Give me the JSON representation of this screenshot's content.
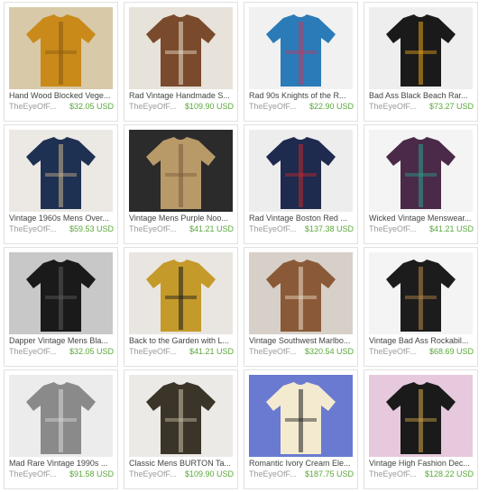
{
  "listings": [
    {
      "title": "Hand Wood Blocked Vege...",
      "shop": "TheEyeOfF...",
      "price": "$32.05 USD",
      "icon": "mustard-shirt-photo",
      "bg": "#d8c9a8",
      "main": "#c98a1a",
      "accent": "#8a5a10"
    },
    {
      "title": "Rad Vintage Handmade S...",
      "shop": "TheEyeOfF...",
      "price": "$109.90 USD",
      "icon": "nordic-cardigan-photo",
      "bg": "#e7e2da",
      "main": "#7a4a2c",
      "accent": "#e8e1cf"
    },
    {
      "title": "Rad 90s Knights of the R...",
      "shop": "TheEyeOfF...",
      "price": "$22.90 USD",
      "icon": "plaid-shirt-photo",
      "bg": "#f1f1f1",
      "main": "#2a7bb8",
      "accent": "#c23a5e"
    },
    {
      "title": "Bad Ass Black Beach Rar...",
      "shop": "TheEyeOfF...",
      "price": "$73.27 USD",
      "icon": "beach-shirt-photo",
      "bg": "#eeeeee",
      "main": "#1a1a1a",
      "accent": "#e8a21a"
    },
    {
      "title": "Vintage 1960s Mens Over...",
      "shop": "TheEyeOfF...",
      "price": "$59.53 USD",
      "icon": "navy-cardigan-photo",
      "bg": "#ece9e4",
      "main": "#1f3152",
      "accent": "#c9b48a"
    },
    {
      "title": "Vintage Mens Purple Noo...",
      "shop": "TheEyeOfF...",
      "price": "$41.21 USD",
      "icon": "floral-skirt-photo",
      "bg": "#2b2b2b",
      "main": "#b89a68",
      "accent": "#7a5a3a"
    },
    {
      "title": "Rad Vintage Boston Red ...",
      "shop": "TheEyeOfF...",
      "price": "$137.38 USD",
      "icon": "boston-jacket-photo",
      "bg": "#ededed",
      "main": "#1e2a4e",
      "accent": "#c0282d"
    },
    {
      "title": "Wicked Vintage Menswear...",
      "shop": "TheEyeOfF...",
      "price": "$41.21 USD",
      "icon": "purple-sweater-photo",
      "bg": "#f4f4f4",
      "main": "#4a2a48",
      "accent": "#2aa08a"
    },
    {
      "title": "Dapper Vintage Mens Bla...",
      "shop": "TheEyeOfF...",
      "price": "$32.05 USD",
      "icon": "black-shoes-photo",
      "bg": "#c8c8c8",
      "main": "#1a1a1a",
      "accent": "#5a5a5a"
    },
    {
      "title": "Back to the Garden with L...",
      "shop": "TheEyeOfF...",
      "price": "$41.21 USD",
      "icon": "gold-vest-photo",
      "bg": "#e9e6e1",
      "main": "#c49a2a",
      "accent": "#1a1a1a"
    },
    {
      "title": "Vintage Southwest Marlbo...",
      "shop": "TheEyeOfF...",
      "price": "$320.54 USD",
      "icon": "sheepskin-coat-photo",
      "bg": "#d6d0c8",
      "main": "#8a5a38",
      "accent": "#e9dcc6"
    },
    {
      "title": "Vintage Bad Ass Rockabil...",
      "shop": "TheEyeOfF...",
      "price": "$68.69 USD",
      "icon": "fedora-hat-photo",
      "bg": "#f4f4f4",
      "main": "#1c1c1c",
      "accent": "#b88a4a"
    },
    {
      "title": "Mad Rare Vintage 1990s ...",
      "shop": "TheEyeOfF...",
      "price": "$91.58 USD",
      "icon": "silver-shirt-photo",
      "bg": "#ececec",
      "main": "#8a8a8a",
      "accent": "#d8d8d8"
    },
    {
      "title": "Classic Mens BURTON Ta...",
      "shop": "TheEyeOfF...",
      "price": "$109.90 USD",
      "icon": "houndstooth-blazer-photo",
      "bg": "#eceae6",
      "main": "#3a3528",
      "accent": "#c9bfa8"
    },
    {
      "title": "Romantic Ivory Cream Ele...",
      "shop": "TheEyeOfF...",
      "price": "$187.75 USD",
      "icon": "ivory-coat-model-photo",
      "bg": "#6a7ad0",
      "main": "#f3ead0",
      "accent": "#1a1a1a"
    },
    {
      "title": "Vintage High Fashion Dec...",
      "shop": "TheEyeOfF...",
      "price": "$128.22 USD",
      "icon": "fashion-model-photo",
      "bg": "#e6c9dc",
      "main": "#1a1a1a",
      "accent": "#d4a84a"
    }
  ]
}
